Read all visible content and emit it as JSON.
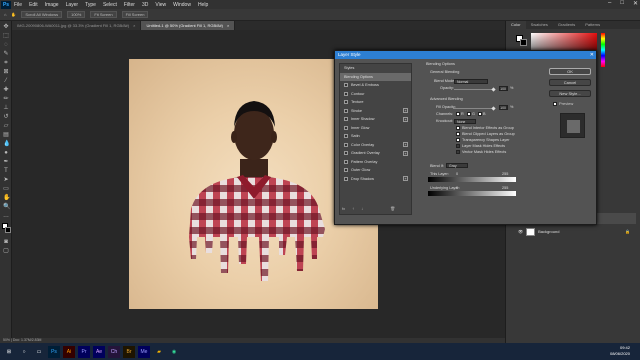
{
  "menubar": {
    "items": [
      "File",
      "Edit",
      "Image",
      "Layer",
      "Type",
      "Select",
      "Filter",
      "3D",
      "View",
      "Window",
      "Help"
    ],
    "app_badge": "Ps"
  },
  "optionsbar": {
    "labels": [
      "Scroll All Windows",
      "100%",
      "Fit Screen",
      "Fill Screen"
    ]
  },
  "tabs": [
    {
      "label": "IMG-20090806-WA0011.jpg @ 33.3% (Gradient Fill 1, RGB/8#)"
    },
    {
      "label": "Untitled-1 @ 50% (Gradient Fill 1, RGB/8#)"
    }
  ],
  "status": "50% | Doc: 1.37M/2.83M",
  "right_panel": {
    "tabs": [
      "Color",
      "Swatches",
      "Gradients",
      "Patterns"
    ],
    "layers": [
      {
        "name": "Gradient Fill 1"
      },
      {
        "name": "Background"
      }
    ]
  },
  "dialog": {
    "title": "Layer Style",
    "styles": [
      {
        "label": "Styles",
        "checkbox": false,
        "plus": false
      },
      {
        "label": "Blending Options",
        "checkbox": false,
        "plus": false,
        "active": true
      },
      {
        "label": "Bevel & Emboss",
        "checkbox": true,
        "plus": false
      },
      {
        "label": "Contour",
        "checkbox": true,
        "plus": false
      },
      {
        "label": "Texture",
        "checkbox": true,
        "plus": false
      },
      {
        "label": "Stroke",
        "checkbox": true,
        "plus": true
      },
      {
        "label": "Inner Shadow",
        "checkbox": true,
        "plus": true
      },
      {
        "label": "Inner Glow",
        "checkbox": true,
        "plus": false
      },
      {
        "label": "Satin",
        "checkbox": true,
        "plus": false
      },
      {
        "label": "Color Overlay",
        "checkbox": true,
        "plus": true
      },
      {
        "label": "Gradient Overlay",
        "checkbox": true,
        "plus": true
      },
      {
        "label": "Pattern Overlay",
        "checkbox": true,
        "plus": false
      },
      {
        "label": "Outer Glow",
        "checkbox": true,
        "plus": false
      },
      {
        "label": "Drop Shadow",
        "checkbox": true,
        "plus": true
      }
    ],
    "blending": {
      "section": "Blending Options",
      "general": "General Blending",
      "blend_mode_label": "Blend Mode:",
      "blend_mode_value": "Normal",
      "opacity_label": "Opacity:",
      "opacity_value": "100",
      "pct": "%",
      "advanced": "Advanced Blending",
      "fill_opacity_label": "Fill Opacity:",
      "fill_opacity_value": "100",
      "channels_label": "Channels:",
      "channels": [
        "R",
        "G",
        "B"
      ],
      "knockout_label": "Knockout:",
      "knockout_value": "None",
      "options": [
        "Blend Interior Effects as Group",
        "Blend Clipped Layers as Group",
        "Transparency Shapes Layer",
        "Layer Mask Hides Effects",
        "Vector Mask Hides Effects"
      ],
      "blend_if_label": "Blend If:",
      "blend_if_value": "Gray",
      "this_layer_label": "This Layer:",
      "underlying_label": "Underlying Layer:",
      "this_layer_low": "0",
      "this_layer_high": "255",
      "under_low": "0",
      "under_high": "255"
    },
    "buttons": {
      "ok": "OK",
      "cancel": "Cancel",
      "new_style": "New Style...",
      "preview": "Preview"
    },
    "footer": [
      "fx",
      "↑",
      "↓",
      "🗑"
    ]
  },
  "taskbar": {
    "apps": [
      "Ps",
      "Ai",
      "Pr",
      "Ae",
      "Ch",
      "Br",
      "Me"
    ],
    "time": "09:42",
    "date": "08/06/2020"
  },
  "colors": {
    "accent": "#2d7fd3",
    "doc_bg": "#ebcfa9"
  }
}
